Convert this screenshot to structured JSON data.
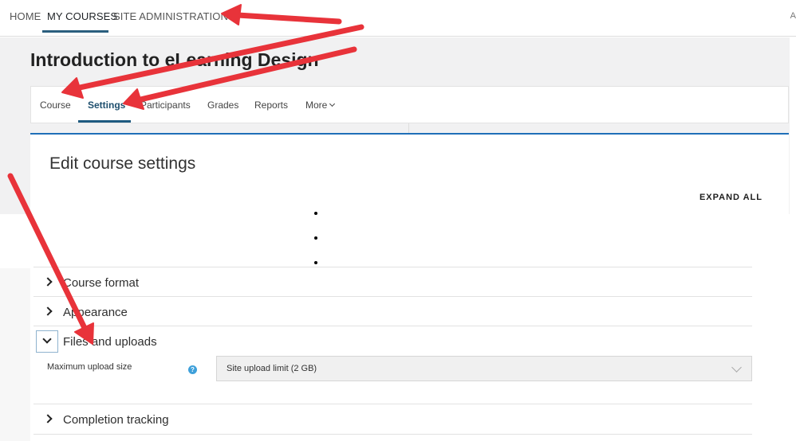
{
  "topnav": {
    "home": "HOME",
    "my_courses": "MY COURSES",
    "site_admin": "SITE ADMINISTRATION",
    "edge": "A"
  },
  "course": {
    "title": "Introduction to eLearning Design"
  },
  "secnav": {
    "tabs": [
      "Course",
      "Settings",
      "Participants",
      "Grades",
      "Reports",
      "More"
    ],
    "active": "Settings"
  },
  "card": {
    "title": "Edit course settings",
    "expand_all": "EXPAND ALL"
  },
  "sections": {
    "course_format": "Course format",
    "appearance": "Appearance",
    "files_uploads": "Files and uploads",
    "completion": "Completion tracking"
  },
  "files_uploads": {
    "field_label": "Maximum upload size",
    "help_icon_glyph": "?",
    "select_value": "Site upload limit (2 GB)"
  },
  "colors": {
    "annotation_arrow": "#e8333a",
    "accent": "#1f6fb8",
    "active_tab": "#1e4f6e"
  }
}
